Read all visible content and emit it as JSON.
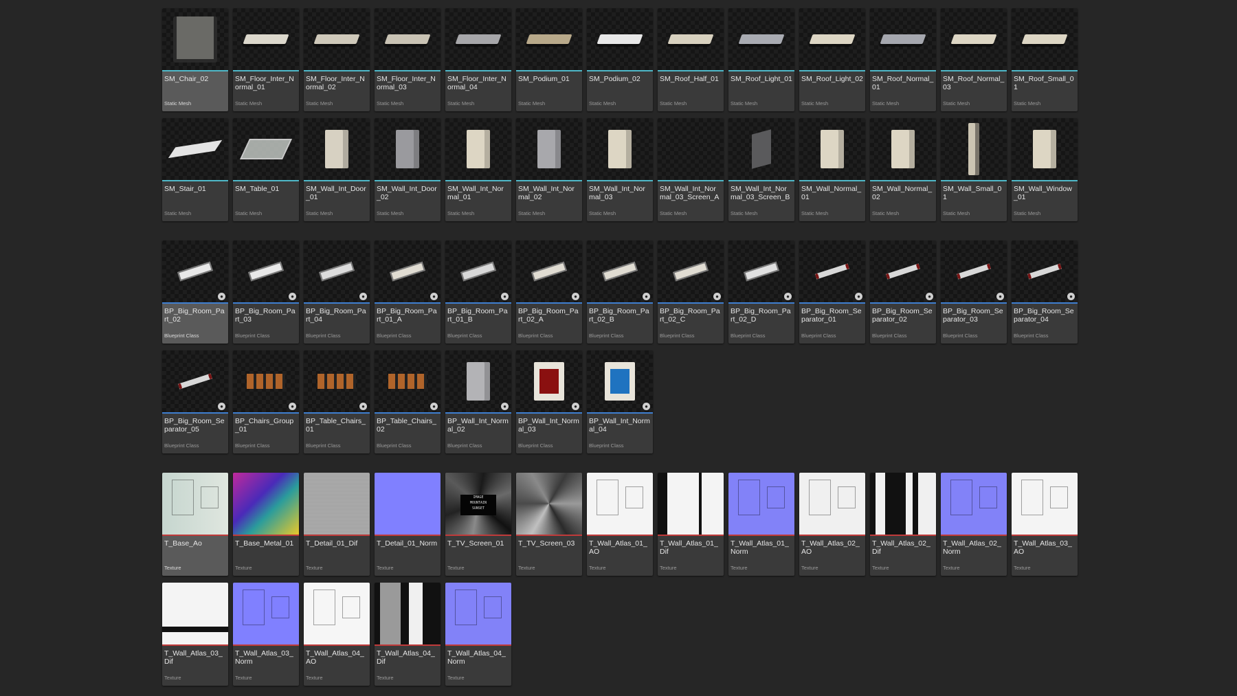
{
  "content_browser": {
    "rows": [
      [
        {
          "name": "SM_Chair_02",
          "type": "Static Mesh",
          "kind": "mesh",
          "selected": true,
          "shape": "chair",
          "color": "#6a6a66"
        },
        {
          "name": "SM_Floor_Inter_Normal_01",
          "type": "Static Mesh",
          "kind": "mesh",
          "shape": "slab",
          "color": "#dcd8cc"
        },
        {
          "name": "SM_Floor_Inter_Normal_02",
          "type": "Static Mesh",
          "kind": "mesh",
          "shape": "slab",
          "color": "#cfc9ba"
        },
        {
          "name": "SM_Floor_Inter_Normal_03",
          "type": "Static Mesh",
          "kind": "mesh",
          "shape": "slab",
          "color": "#c9c3b4"
        },
        {
          "name": "SM_Floor_Inter_Normal_04",
          "type": "Static Mesh",
          "kind": "mesh",
          "shape": "slab",
          "color": "#a7a7aa"
        },
        {
          "name": "SM_Podium_01",
          "type": "Static Mesh",
          "kind": "mesh",
          "shape": "slab",
          "color": "#b8a98a"
        },
        {
          "name": "SM_Podium_02",
          "type": "Static Mesh",
          "kind": "mesh",
          "shape": "slab",
          "color": "#e8e8e8"
        },
        {
          "name": "SM_Roof_Half_01",
          "type": "Static Mesh",
          "kind": "mesh",
          "shape": "slab",
          "color": "#d8d1bf"
        },
        {
          "name": "SM_Roof_Light_01",
          "type": "Static Mesh",
          "kind": "mesh",
          "shape": "slab",
          "color": "#a9abb2"
        },
        {
          "name": "SM_Roof_Light_02",
          "type": "Static Mesh",
          "kind": "mesh",
          "shape": "slab",
          "color": "#ddd6c4"
        },
        {
          "name": "SM_Roof_Normal_01",
          "type": "Static Mesh",
          "kind": "mesh",
          "shape": "slab",
          "color": "#a5a7ae"
        },
        {
          "name": "SM_Roof_Normal_03",
          "type": "Static Mesh",
          "kind": "mesh",
          "shape": "slab",
          "color": "#ddd6c4"
        },
        {
          "name": "SM_Roof_Small_01",
          "type": "Static Mesh",
          "kind": "mesh",
          "shape": "slab",
          "color": "#ddd6c4"
        }
      ],
      [
        {
          "name": "SM_Stair_01",
          "type": "Static Mesh",
          "kind": "mesh",
          "shape": "stair",
          "color": "#e4e4e4"
        },
        {
          "name": "SM_Table_01",
          "type": "Static Mesh",
          "kind": "mesh",
          "shape": "table",
          "color": "#bfc4c0"
        },
        {
          "name": "SM_Wall_Int_Door_01",
          "type": "Static Mesh",
          "kind": "mesh",
          "shape": "box",
          "color": "#d7d1c2"
        },
        {
          "name": "SM_Wall_Int_Door_02",
          "type": "Static Mesh",
          "kind": "mesh",
          "shape": "box",
          "color": "#9a9a9e"
        },
        {
          "name": "SM_Wall_Int_Normal_01",
          "type": "Static Mesh",
          "kind": "mesh",
          "shape": "box",
          "color": "#ddd6c4"
        },
        {
          "name": "SM_Wall_Int_Normal_02",
          "type": "Static Mesh",
          "kind": "mesh",
          "shape": "box",
          "color": "#a8a8ac"
        },
        {
          "name": "SM_Wall_Int_Normal_03",
          "type": "Static Mesh",
          "kind": "mesh",
          "shape": "box",
          "color": "#ddd6c4"
        },
        {
          "name": "SM_Wall_Int_Normal_03_Screen_A",
          "type": "Static Mesh",
          "kind": "mesh",
          "shape": "empty",
          "color": "#151515"
        },
        {
          "name": "SM_Wall_Int_Normal_03_Screen_B",
          "type": "Static Mesh",
          "kind": "mesh",
          "shape": "panel",
          "color": "#5a5a5c"
        },
        {
          "name": "SM_Wall_Normal_01",
          "type": "Static Mesh",
          "kind": "mesh",
          "shape": "box",
          "color": "#ddd6c4"
        },
        {
          "name": "SM_Wall_Normal_02",
          "type": "Static Mesh",
          "kind": "mesh",
          "shape": "box",
          "color": "#ddd6c4"
        },
        {
          "name": "SM_Wall_Small_01",
          "type": "Static Mesh",
          "kind": "mesh",
          "shape": "thin",
          "color": "#cbc4b2"
        },
        {
          "name": "SM_Wall_Window_01",
          "type": "Static Mesh",
          "kind": "mesh",
          "shape": "box",
          "color": "#ddd6c4"
        }
      ],
      [
        {
          "name": "BP_Big_Room_Part_02",
          "type": "Blueprint Class",
          "kind": "bp",
          "selected": true,
          "shape": "room",
          "color": "#e8e8e8"
        },
        {
          "name": "BP_Big_Room_Part_03",
          "type": "Blueprint Class",
          "kind": "bp",
          "shape": "room",
          "color": "#e8e8e8"
        },
        {
          "name": "BP_Big_Room_Part_04",
          "type": "Blueprint Class",
          "kind": "bp",
          "shape": "room",
          "color": "#dcdcdc"
        },
        {
          "name": "BP_Big_Room_Part_01_A",
          "type": "Blueprint Class",
          "kind": "bp",
          "shape": "room",
          "color": "#e0dcd2"
        },
        {
          "name": "BP_Big_Room_Part_01_B",
          "type": "Blueprint Class",
          "kind": "bp",
          "shape": "room",
          "color": "#d8d8d8"
        },
        {
          "name": "BP_Big_Room_Part_02_A",
          "type": "Blueprint Class",
          "kind": "bp",
          "shape": "room",
          "color": "#e0dcd2"
        },
        {
          "name": "BP_Big_Room_Part_02_B",
          "type": "Blueprint Class",
          "kind": "bp",
          "shape": "room",
          "color": "#e0dcd2"
        },
        {
          "name": "BP_Big_Room_Part_02_C",
          "type": "Blueprint Class",
          "kind": "bp",
          "shape": "room",
          "color": "#e0dcd2"
        },
        {
          "name": "BP_Big_Room_Part_02_D",
          "type": "Blueprint Class",
          "kind": "bp",
          "shape": "room",
          "color": "#e0e0e0"
        },
        {
          "name": "BP_Big_Room_Separator_01",
          "type": "Blueprint Class",
          "kind": "bp",
          "shape": "sep",
          "color": "#d8d8d8"
        },
        {
          "name": "BP_Big_Room_Separator_02",
          "type": "Blueprint Class",
          "kind": "bp",
          "shape": "sep",
          "color": "#d8d8d8"
        },
        {
          "name": "BP_Big_Room_Separator_03",
          "type": "Blueprint Class",
          "kind": "bp",
          "shape": "sep",
          "color": "#d8d8d8"
        },
        {
          "name": "BP_Big_Room_Separator_04",
          "type": "Blueprint Class",
          "kind": "bp",
          "shape": "sep",
          "color": "#d8d8d8"
        }
      ],
      [
        {
          "name": "BP_Big_Room_Separator_05",
          "type": "Blueprint Class",
          "kind": "bp",
          "shape": "sep",
          "color": "#d8d8d8"
        },
        {
          "name": "BP_Chairs_Group_01",
          "type": "Blueprint Class",
          "kind": "bp",
          "shape": "chairs",
          "color": "#b0642a"
        },
        {
          "name": "BP_Table_Chairs_01",
          "type": "Blueprint Class",
          "kind": "bp",
          "shape": "chairs",
          "color": "#b0642a"
        },
        {
          "name": "BP_Table_Chairs_02",
          "type": "Blueprint Class",
          "kind": "bp",
          "shape": "chairs",
          "color": "#b0642a"
        },
        {
          "name": "BP_Wall_Int_Normal_02",
          "type": "Blueprint Class",
          "kind": "bp",
          "shape": "box",
          "color": "#b3b3b6"
        },
        {
          "name": "BP_Wall_Int_Normal_03",
          "type": "Blueprint Class",
          "kind": "bp",
          "shape": "screen",
          "color": "#e8e4da",
          "accent": "#8a1010"
        },
        {
          "name": "BP_Wall_Int_Normal_04",
          "type": "Blueprint Class",
          "kind": "bp",
          "shape": "screen",
          "color": "#e8e4da",
          "accent": "#1f73c0"
        }
      ],
      [
        {
          "name": "T_Base_Ao",
          "type": "Texture",
          "kind": "tex",
          "selected": true,
          "tex": "ao",
          "color": "#cfd8d2"
        },
        {
          "name": "T_Base_Metal_01",
          "type": "Texture",
          "kind": "tex",
          "tex": "metal",
          "color": "#7a2aa8"
        },
        {
          "name": "T_Detail_01_Dif",
          "type": "Texture",
          "kind": "tex",
          "tex": "noise",
          "color": "#a6a6a6"
        },
        {
          "name": "T_Detail_01_Norm",
          "type": "Texture",
          "kind": "tex",
          "tex": "flat",
          "color": "#8080ff"
        },
        {
          "name": "T_TV_Screen_01",
          "type": "Texture",
          "kind": "tex",
          "tex": "tv",
          "color": "#2a2a2a"
        },
        {
          "name": "T_TV_Screen_03",
          "type": "Texture",
          "kind": "tex",
          "tex": "shards",
          "color": "#6a6a6a"
        },
        {
          "name": "T_Wall_Atlas_01_AO",
          "type": "Texture",
          "kind": "tex",
          "tex": "lines",
          "color": "#f4f4f4"
        },
        {
          "name": "T_Wall_Atlas_01_Dif",
          "type": "Texture",
          "kind": "tex",
          "tex": "bw",
          "color": "#f4f4f4"
        },
        {
          "name": "T_Wall_Atlas_01_Norm",
          "type": "Texture",
          "kind": "tex",
          "tex": "lines",
          "color": "#8282f8"
        },
        {
          "name": "T_Wall_Atlas_02_AO",
          "type": "Texture",
          "kind": "tex",
          "tex": "lines",
          "color": "#f0f0f0"
        },
        {
          "name": "T_Wall_Atlas_02_Dif",
          "type": "Texture",
          "kind": "tex",
          "tex": "bw2",
          "color": "#f0f0f0"
        },
        {
          "name": "T_Wall_Atlas_02_Norm",
          "type": "Texture",
          "kind": "tex",
          "tex": "lines",
          "color": "#8282f8"
        },
        {
          "name": "T_Wall_Atlas_03_AO",
          "type": "Texture",
          "kind": "tex",
          "tex": "lines",
          "color": "#f4f4f4"
        }
      ],
      [
        {
          "name": "T_Wall_Atlas_03_Dif",
          "type": "Texture",
          "kind": "tex",
          "tex": "bw3",
          "color": "#f4f4f4"
        },
        {
          "name": "T_Wall_Atlas_03_Norm",
          "type": "Texture",
          "kind": "tex",
          "tex": "lines",
          "color": "#8080ff"
        },
        {
          "name": "T_Wall_Atlas_04_AO",
          "type": "Texture",
          "kind": "tex",
          "tex": "lines",
          "color": "#f6f6f6"
        },
        {
          "name": "T_Wall_Atlas_04_Dif",
          "type": "Texture",
          "kind": "tex",
          "tex": "bw4",
          "color": "#111111"
        },
        {
          "name": "T_Wall_Atlas_04_Norm",
          "type": "Texture",
          "kind": "tex",
          "tex": "lines",
          "color": "#8282f8"
        }
      ]
    ],
    "tv_screen_text": "IMAGE\nMOUNTAIN\nSUNSET"
  }
}
